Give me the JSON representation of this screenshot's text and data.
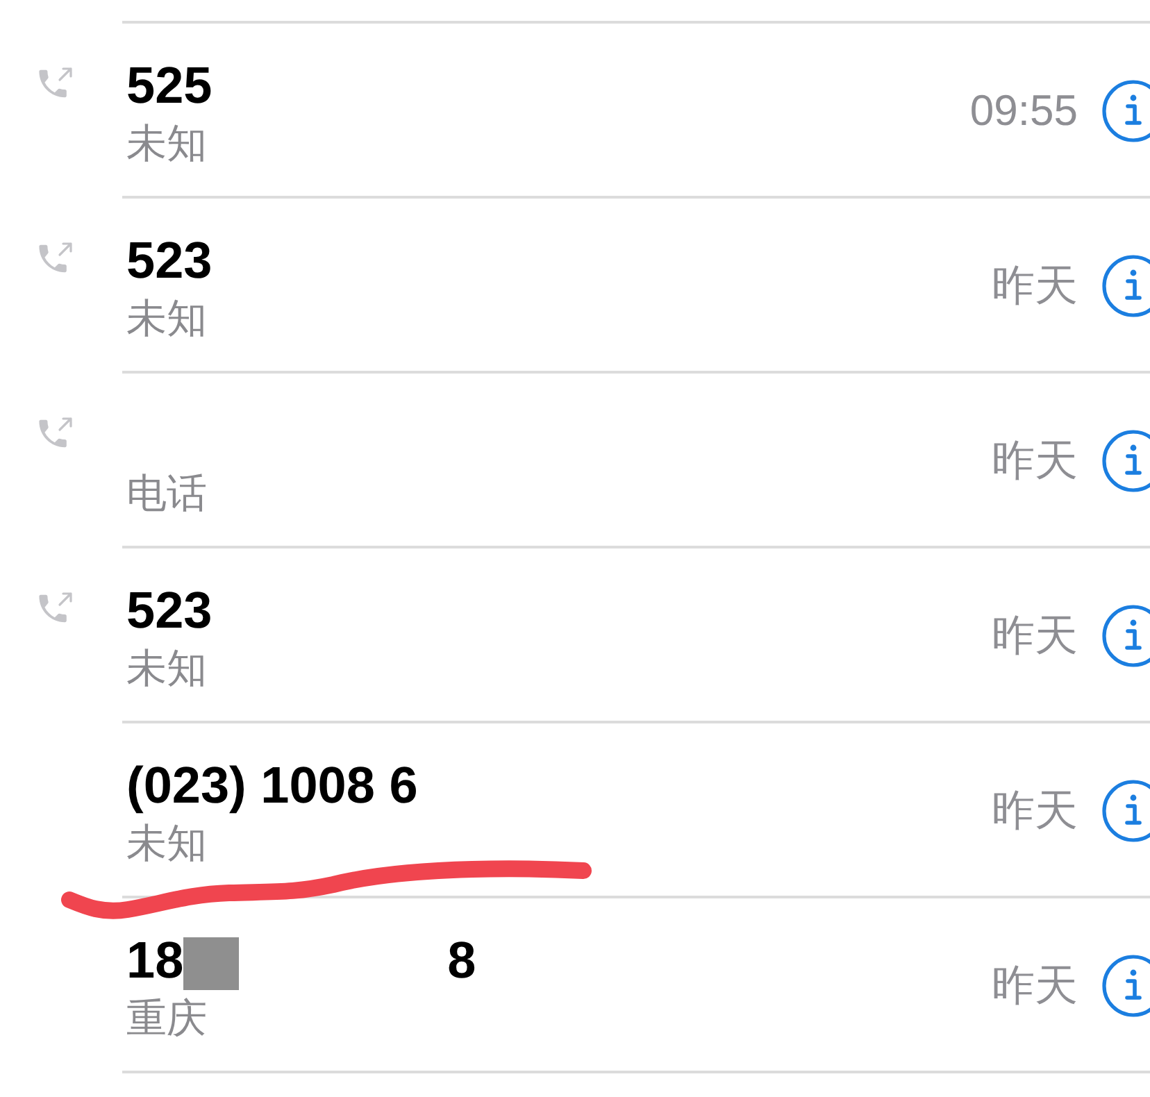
{
  "calls": [
    {
      "outgoing": true,
      "name": "525",
      "label": "未知",
      "time": "09:55"
    },
    {
      "outgoing": true,
      "name": "523",
      "label": "未知",
      "time": "昨天"
    },
    {
      "outgoing": true,
      "label": "电话",
      "time": "昨天"
    },
    {
      "outgoing": true,
      "name": "523",
      "label": "未知",
      "time": "昨天"
    },
    {
      "outgoing": false,
      "name": "(023) 1008 6",
      "label": "未知",
      "time": "昨天"
    },
    {
      "outgoing": false,
      "name": "18",
      "redacted": true,
      "name_end": "8",
      "label": "重庆",
      "time": "昨天"
    }
  ]
}
